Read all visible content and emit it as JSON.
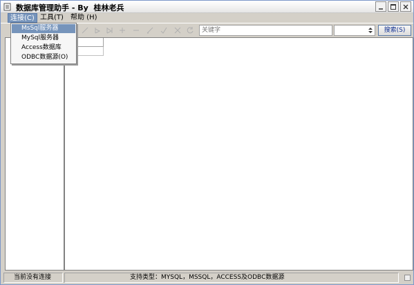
{
  "window": {
    "title": "数据库管理助手 - By  桂林老兵"
  },
  "menu": {
    "items": [
      {
        "label": "连接(C)"
      },
      {
        "label": "工具(T)"
      },
      {
        "label": "帮助 (H)"
      }
    ]
  },
  "dropdown": {
    "items": [
      {
        "label": "MsSql服务器"
      },
      {
        "label": "MySql服务器"
      },
      {
        "label": "Access数据库"
      },
      {
        "label": "ODBC数据源(O)"
      }
    ]
  },
  "toolbar": {
    "keyword_placeholder": "关键字",
    "search_label": "搜索(S)",
    "icons": [
      "first-record-icon",
      "prev-record-icon",
      "next-record-icon",
      "last-record-icon",
      "insert-icon",
      "delete-icon",
      "edit-icon",
      "post-icon",
      "cancel-icon",
      "refresh-icon"
    ]
  },
  "status": {
    "connection": "当前没有连接",
    "supported_types": "支持类型：MYSQL，MSSQL，ACCESS及ODBC数据源"
  },
  "colors": {
    "menu_highlight": "#7694bb",
    "window_bg": "#d4d0c8",
    "title_border": "#7a96c8"
  }
}
